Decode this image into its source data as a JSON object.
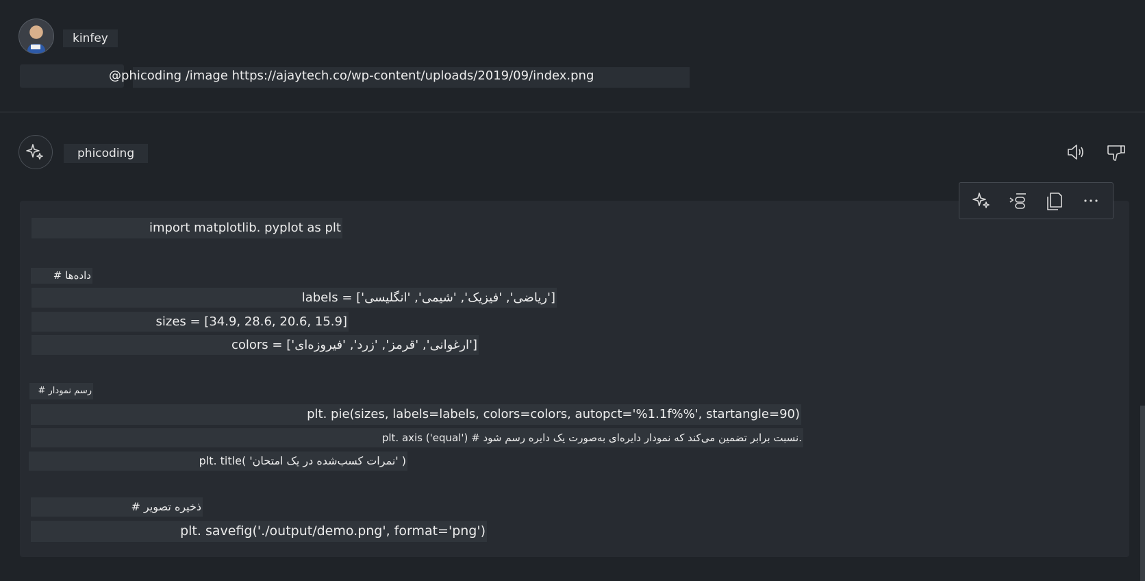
{
  "user": {
    "name": "kinfey",
    "prompt": "@phicoding /image https://ajaytech.co/wp-content/uploads/2019/09/index.png"
  },
  "assistant": {
    "name": "phicoding",
    "actions": [
      "speaker-icon",
      "thumbs-down-icon"
    ]
  },
  "code_toolbar": [
    "sparkle-icon",
    "insert-code-icon",
    "copy-icon",
    "more-icon"
  ],
  "code": {
    "line1": "import matplotlib. pyplot as plt",
    "line2": "# داده‌ها",
    "line3": "labels = ['ریاضی', 'فیزیک', 'شیمی', 'انگلیسی']",
    "line4": "sizes = [34.9, 28.6, 20.6, 15.9]",
    "line5": "colors = ['ارغوانی', 'قرمز', 'زرد', 'فیروزه‌ای']",
    "line6": "# رسم نمودار",
    "line7": "plt. pie(sizes, labels=labels, colors=colors, autopct='%1.1f%%', startangle=90)",
    "line8": "plt. axis ('equal') # نسبت برابر تضمین می‌کند که نمودار دایره‌ای به‌صورت یک دایره رسم شود.",
    "line9": "plt. title( 'نمرات کسب‌شده در یک امتحان' )",
    "line10": "# ذخیره تصویر",
    "line11": "plt. savefig('./output/demo.png', format='png')"
  }
}
